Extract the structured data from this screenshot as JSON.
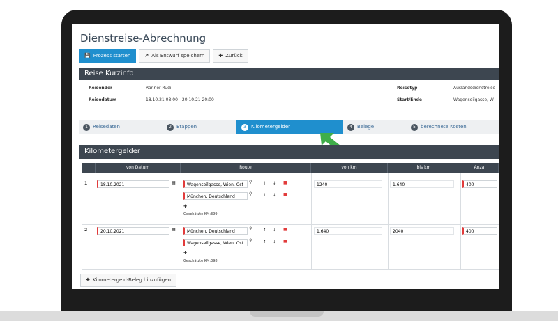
{
  "app": {
    "title": "Dienstreise-Abrechnung"
  },
  "toolbar": {
    "start_label": "Prozess starten",
    "draft_label": "Als Entwurf speichern",
    "back_label": "Zurück"
  },
  "summary": {
    "header": "Reise Kurzinfo",
    "reisender_label": "Reisender",
    "reisender_value": "Ranner Rudi",
    "reisedatum_label": "Reisedatum",
    "reisedatum_value": "18.10.21 08:00 - 20.10.21 20:00",
    "reisetyp_label": "Reisetyp",
    "reisetyp_value": "Auslandsdienstreise",
    "startende_label": "Start/Ende",
    "startende_value": "Wagenseilgasse, W"
  },
  "steps": [
    {
      "num": "1",
      "label": "Reisedaten"
    },
    {
      "num": "2",
      "label": "Etappen"
    },
    {
      "num": "3",
      "label": "Kilometergelder"
    },
    {
      "num": "4",
      "label": "Belege"
    },
    {
      "num": "5",
      "label": "berechnete Kosten"
    }
  ],
  "section": {
    "header": "Kilometergelder"
  },
  "table": {
    "columns": [
      "von Datum",
      "Route",
      "von km",
      "bis km",
      "Anza"
    ],
    "rows": [
      {
        "num": "1",
        "date": "18.10.2021",
        "route": [
          "Wagenseilgasse, Wien, Ost",
          "München, Deutschland"
        ],
        "estimate": "Geschätzte KM:399",
        "von_km": "1240",
        "bis_km": "1.640",
        "anzahl": "400"
      },
      {
        "num": "2",
        "date": "20.10.2021",
        "route": [
          "München, Deutschland",
          "Wagenseilgasse, Wien, Ost"
        ],
        "estimate": "Geschätzte KM:398",
        "von_km": "1.640",
        "bis_km": "2040",
        "anzahl": "400"
      }
    ]
  },
  "footer": {
    "add_label": "Kilometergeld-Beleg hinzufügen"
  },
  "icons": {
    "start": "save-icon",
    "draft": "external-icon",
    "back": "arrow-left-icon",
    "calendar": "calendar-icon",
    "pin": "pin-icon",
    "up": "arrow-up-icon",
    "down": "arrow-down-icon",
    "delete": "trash-icon",
    "add": "plus-icon"
  },
  "colors": {
    "accent": "#1f8fce",
    "header": "#3d4650",
    "required": "#e23b3b",
    "arrow": "#3fae49"
  }
}
